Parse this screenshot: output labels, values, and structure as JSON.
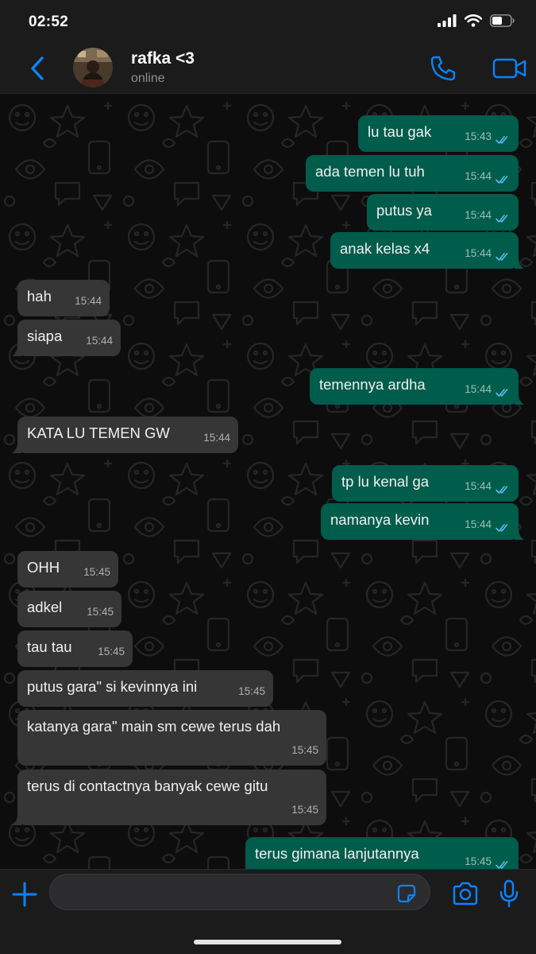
{
  "status_bar": {
    "time": "02:52"
  },
  "header": {
    "contact_name": "rafka <3",
    "contact_status": "online"
  },
  "messages": [
    {
      "direction": "out",
      "text": "lu tau gak",
      "time": "15:43",
      "read": true
    },
    {
      "direction": "out",
      "text": "ada temen lu tuh",
      "time": "15:44",
      "read": true
    },
    {
      "direction": "out",
      "text": "putus ya",
      "time": "15:44",
      "read": true
    },
    {
      "direction": "out",
      "text": "anak kelas x4",
      "time": "15:44",
      "read": true
    },
    {
      "direction": "in",
      "text": "hah",
      "time": "15:44"
    },
    {
      "direction": "in",
      "text": "siapa",
      "time": "15:44"
    },
    {
      "direction": "out",
      "text": "temennya ardha",
      "time": "15:44",
      "read": true
    },
    {
      "direction": "in",
      "text": "KATA LU TEMEN GW",
      "time": "15:44"
    },
    {
      "direction": "out",
      "text": "tp lu kenal ga",
      "time": "15:44",
      "read": true
    },
    {
      "direction": "out",
      "text": "namanya kevin",
      "time": "15:44",
      "read": true
    },
    {
      "direction": "in",
      "text": "OHH",
      "time": "15:45"
    },
    {
      "direction": "in",
      "text": "adkel",
      "time": "15:45"
    },
    {
      "direction": "in",
      "text": "tau tau",
      "time": "15:45"
    },
    {
      "direction": "in",
      "text": "putus gara\" si kevinnya ini",
      "time": "15:45"
    },
    {
      "direction": "in",
      "text": "katanya gara\" main sm cewe terus dah",
      "time": "15:45"
    },
    {
      "direction": "in",
      "text": "terus di contactnya banyak cewe gitu",
      "time": "15:45"
    },
    {
      "direction": "out",
      "text": "terus gimana lanjutannya",
      "time": "15:45",
      "read": true
    }
  ],
  "input": {
    "placeholder": "",
    "value": ""
  },
  "colors": {
    "accent": "#0a84ff",
    "outgoing_bubble": "#005c4b",
    "incoming_bubble": "#363636",
    "read_ticks": "#53bdeb",
    "bar_background": "#1b1b1b"
  },
  "icons": {
    "back": "chevron-left-icon",
    "call": "phone-icon",
    "video": "video-camera-icon",
    "attach": "plus-icon",
    "sticker": "sticker-icon",
    "camera": "camera-icon",
    "mic": "microphone-icon",
    "scroll": "chevron-down-circle-icon"
  }
}
